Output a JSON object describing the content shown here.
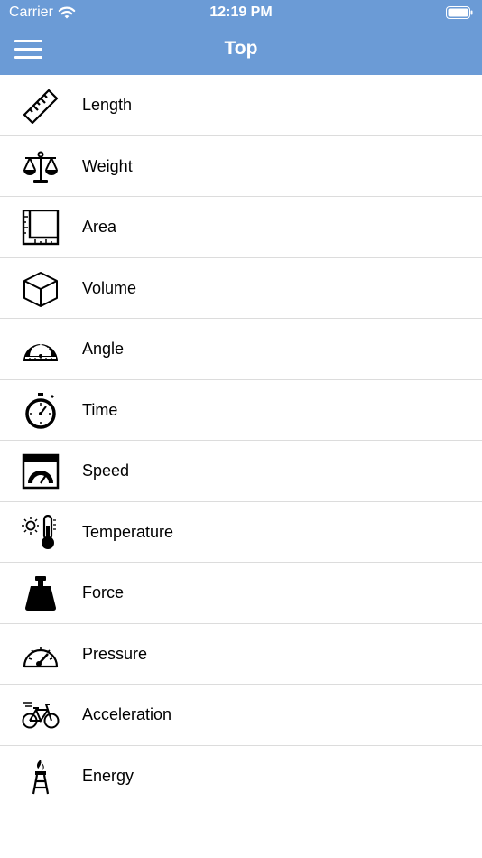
{
  "status_bar": {
    "carrier": "Carrier",
    "time": "12:19 PM"
  },
  "nav": {
    "title": "Top",
    "menu_icon": "hamburger-menu-icon"
  },
  "colors": {
    "nav_background": "#6b9bd6",
    "divider": "#dcdcdc"
  },
  "categories": [
    {
      "label": "Length",
      "icon": "ruler-icon"
    },
    {
      "label": "Weight",
      "icon": "scale-icon"
    },
    {
      "label": "Area",
      "icon": "area-icon"
    },
    {
      "label": "Volume",
      "icon": "cube-icon"
    },
    {
      "label": "Angle",
      "icon": "protractor-icon"
    },
    {
      "label": "Time",
      "icon": "stopwatch-icon"
    },
    {
      "label": "Speed",
      "icon": "speedometer-icon"
    },
    {
      "label": "Temperature",
      "icon": "thermometer-icon"
    },
    {
      "label": "Force",
      "icon": "weight-icon"
    },
    {
      "label": "Pressure",
      "icon": "gauge-icon"
    },
    {
      "label": "Acceleration",
      "icon": "bicycle-icon"
    },
    {
      "label": "Energy",
      "icon": "torch-icon"
    }
  ]
}
